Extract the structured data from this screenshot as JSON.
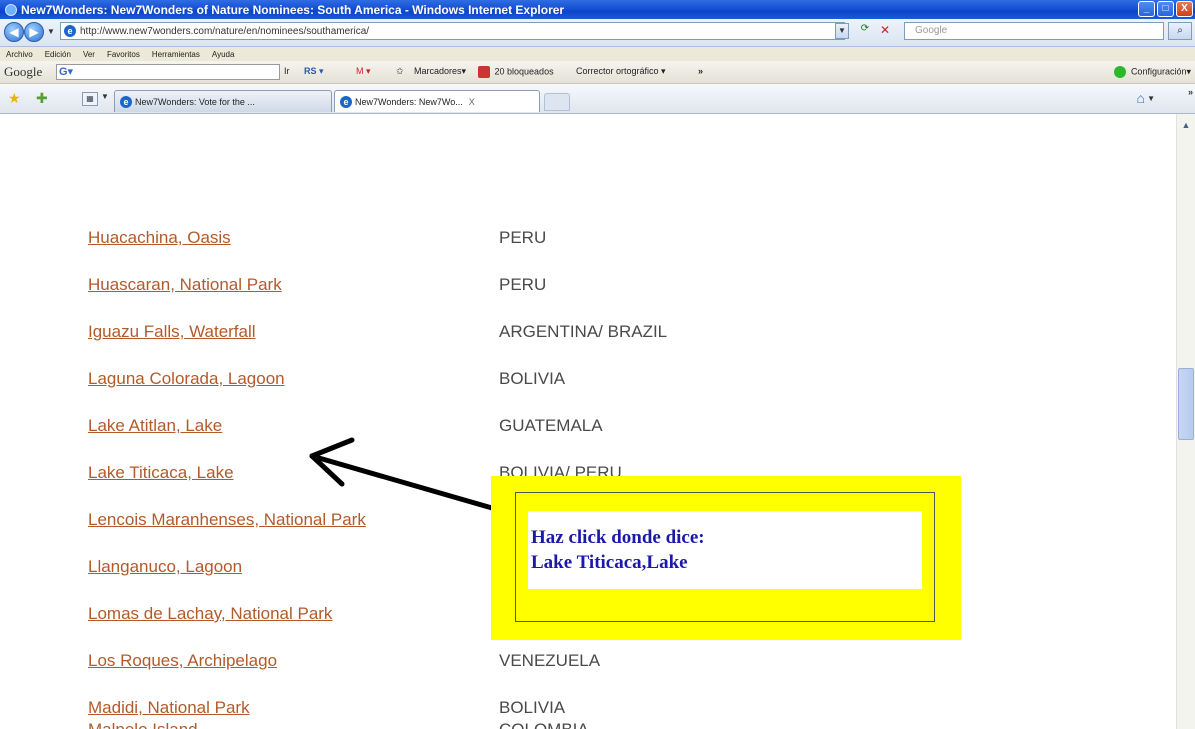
{
  "window": {
    "title": "New7Wonders: New7Wonders of Nature Nominees: South America - Windows Internet Explorer",
    "controls": [
      "_",
      "□",
      "X"
    ]
  },
  "address": {
    "url": "http://www.new7wonders.com/nature/en/nominees/southamerica/",
    "search_placeholder": "Google"
  },
  "menu": [
    "Archivo",
    "Edición",
    "Ver",
    "Favoritos",
    "Herramientas",
    "Ayuda"
  ],
  "google_toolbar": {
    "logo": "Google",
    "field_value": "G▾",
    "items": [
      "Ir",
      "RS ▾",
      "M ▾",
      "Marcadores▾",
      "20 bloqueados",
      "Corrector ortográfico ▾",
      "»"
    ],
    "settings": "Configuración▾"
  },
  "tabs": [
    {
      "label": "New7Wonders: Vote for the ...",
      "active": false
    },
    {
      "label": "New7Wonders: New7Wo...",
      "active": true
    }
  ],
  "nominees": [
    {
      "name": "Huacachina, Oasis",
      "country": "PERU"
    },
    {
      "name": "Huascaran, National Park",
      "country": "PERU"
    },
    {
      "name": "Iguazu Falls, Waterfall",
      "country": "ARGENTINA/ BRAZIL"
    },
    {
      "name": "Laguna Colorada, Lagoon",
      "country": "BOLIVIA"
    },
    {
      "name": "Lake Atitlan, Lake",
      "country": "GUATEMALA"
    },
    {
      "name": "Lake Titicaca, Lake",
      "country": "BOLIVIA/ PERU"
    },
    {
      "name": "Lencois Maranhenses, National Park",
      "country": ""
    },
    {
      "name": "Llanganuco, Lagoon",
      "country": ""
    },
    {
      "name": "Lomas de Lachay, National Park",
      "country": ""
    },
    {
      "name": "Los Roques, Archipelago",
      "country": "VENEZUELA"
    },
    {
      "name": "Madidi, National Park",
      "country": "BOLIVIA"
    },
    {
      "name": "Malpelo Island",
      "country": "COLOMBIA"
    }
  ],
  "annotation": {
    "line1": "Haz click donde dice:",
    "line2": "Lake Titicaca,Lake"
  },
  "colors": {
    "link": "#b35a2a",
    "country": "#4a4a4a",
    "annotation_bg": "#ffff00",
    "annotation_text": "#1b1aa8"
  }
}
